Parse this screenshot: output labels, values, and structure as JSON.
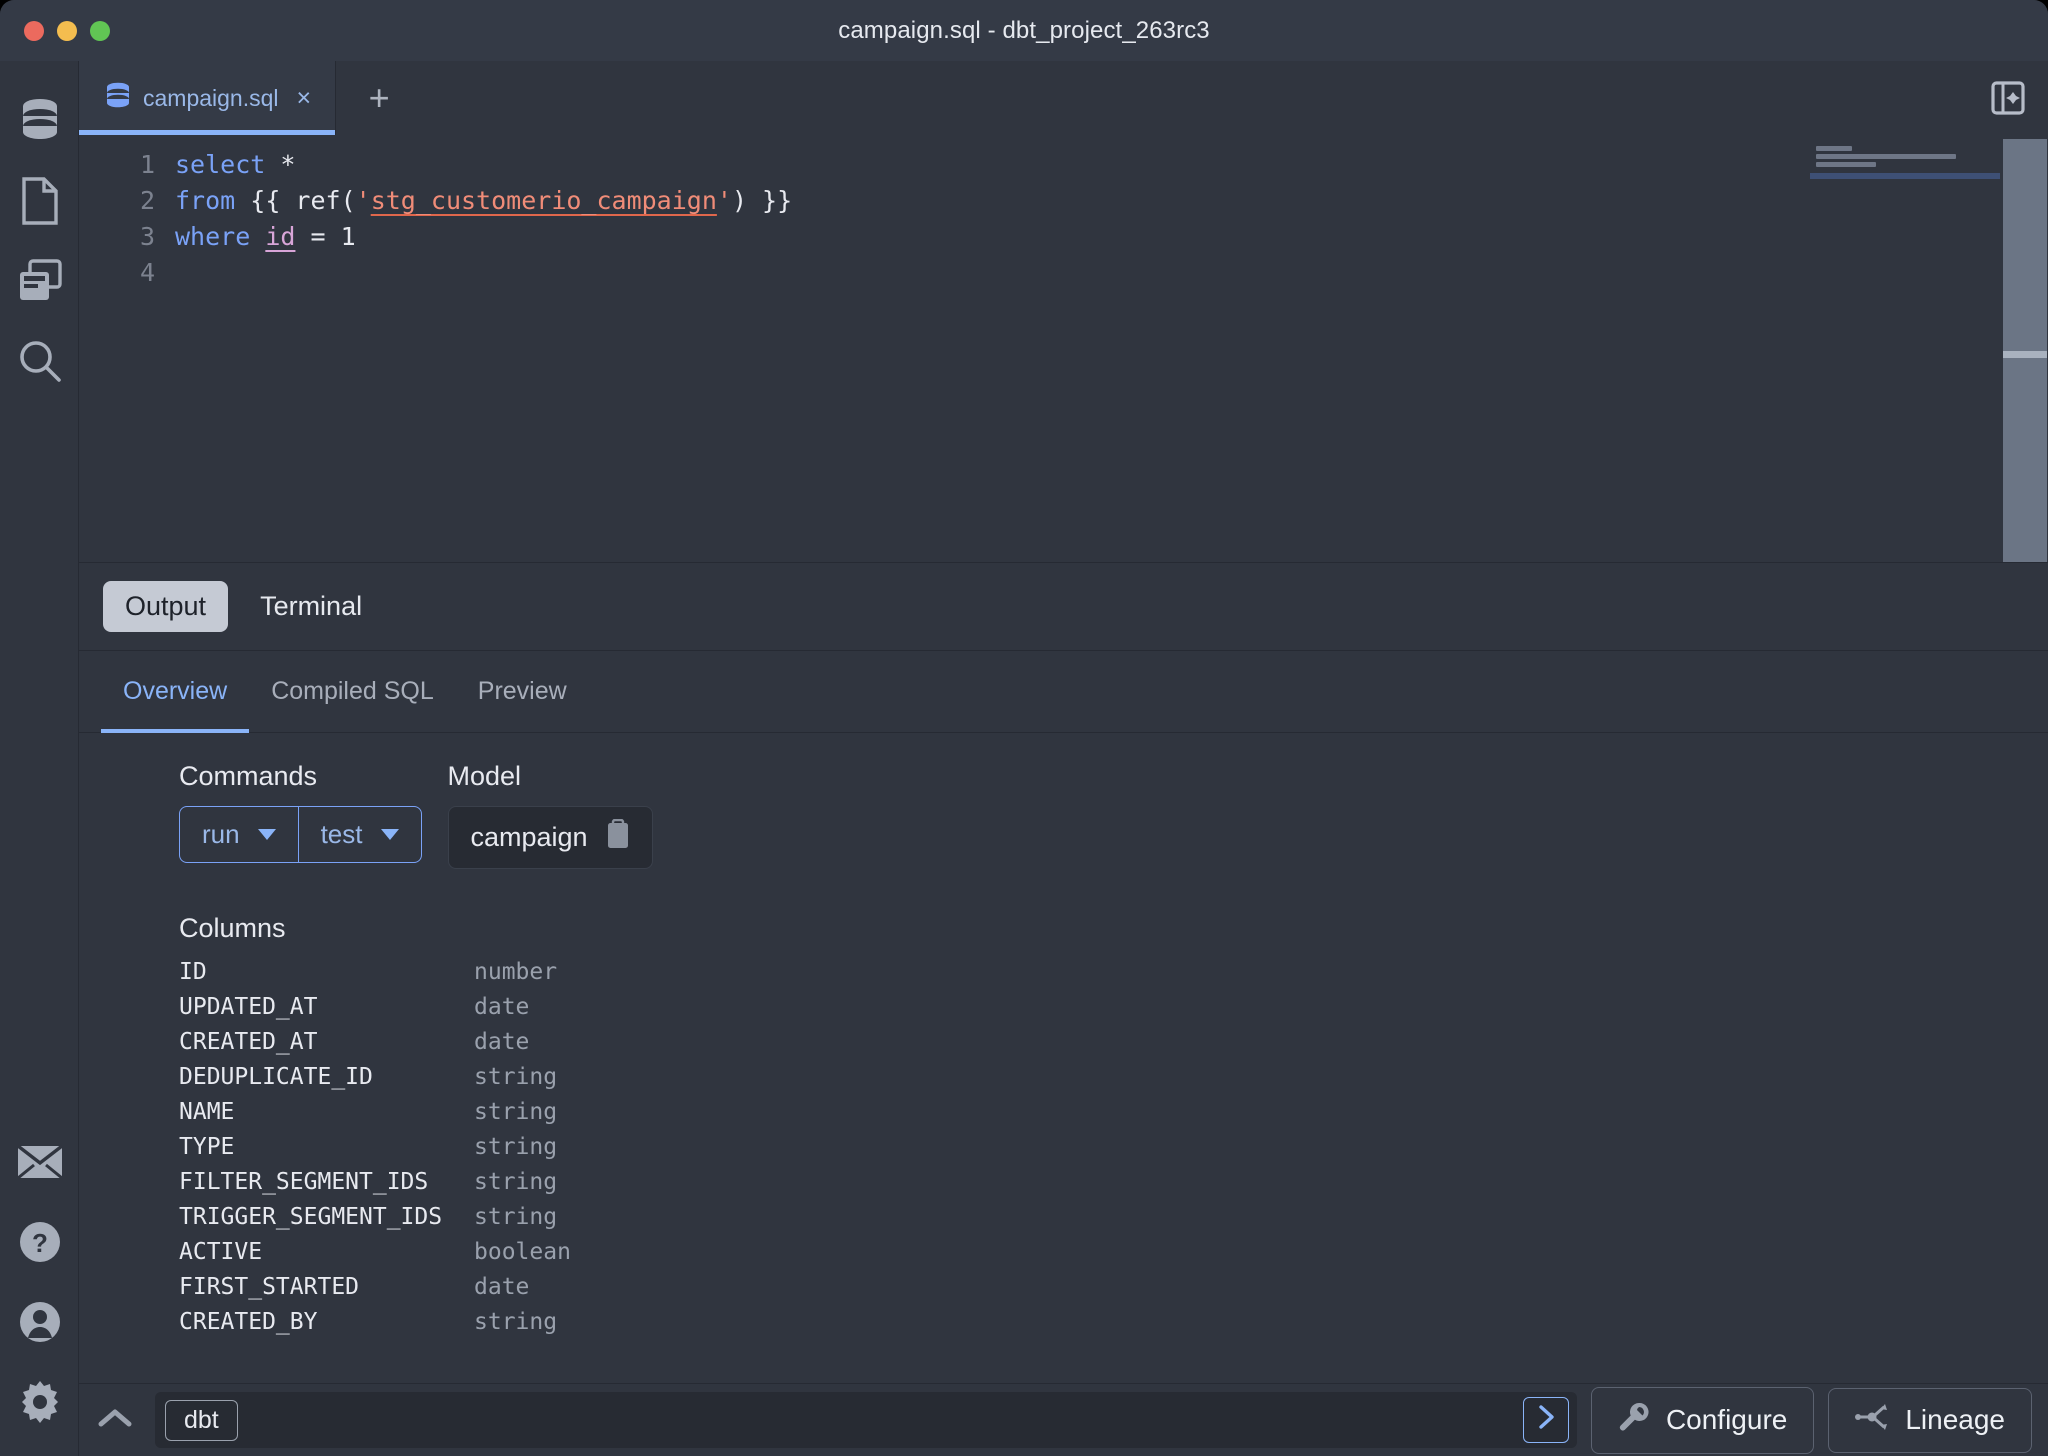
{
  "window": {
    "title": "campaign.sql - dbt_project_263rc3",
    "traffic_lights": [
      "close-red",
      "minimize-yellow",
      "maximize-green"
    ]
  },
  "rail": {
    "top_items": [
      {
        "name": "database-icon",
        "label": "Database"
      },
      {
        "name": "file-icon",
        "label": "File"
      },
      {
        "name": "copy-panels-icon",
        "label": "Panels"
      },
      {
        "name": "search-icon",
        "label": "Search"
      }
    ],
    "bottom_items": [
      {
        "name": "mail-icon",
        "label": "Mail"
      },
      {
        "name": "help-icon",
        "label": "Help"
      },
      {
        "name": "account-icon",
        "label": "Account"
      },
      {
        "name": "settings-gear-icon",
        "label": "Settings"
      }
    ]
  },
  "tabs": {
    "items": [
      {
        "label": "campaign.sql",
        "close": "×",
        "active": true
      }
    ],
    "new_tab_label": "+",
    "panel_toggle_name": "split-panel-add-icon"
  },
  "editor": {
    "lines": [
      {
        "num": "1",
        "segments": [
          {
            "text": "select",
            "cls": "kw"
          },
          {
            "text": " *",
            "cls": "plain"
          }
        ]
      },
      {
        "num": "2",
        "segments": [
          {
            "text": "from",
            "cls": "kw"
          },
          {
            "text": " {{ ref(",
            "cls": "jinja"
          },
          {
            "text": "'",
            "cls": "str"
          },
          {
            "text": "stg_customerio_campaign",
            "cls": "ref"
          },
          {
            "text": "'",
            "cls": "str"
          },
          {
            "text": ") }}",
            "cls": "jinja"
          }
        ]
      },
      {
        "num": "3",
        "segments": [
          {
            "text": "where",
            "cls": "kw"
          },
          {
            "text": " ",
            "cls": "plain"
          },
          {
            "text": "id",
            "cls": "ident"
          },
          {
            "text": " = ",
            "cls": "plain"
          },
          {
            "text": "1",
            "cls": "num"
          }
        ]
      },
      {
        "num": "4",
        "segments": []
      }
    ],
    "plain_text": "select *\nfrom {{ ref('stg_customerio_campaign') }}\nwhere id = 1\n"
  },
  "output": {
    "pane_tabs": [
      {
        "label": "Output",
        "selected": true
      },
      {
        "label": "Terminal",
        "selected": false
      }
    ],
    "sub_tabs": [
      {
        "label": "Overview",
        "selected": true
      },
      {
        "label": "Compiled SQL",
        "selected": false
      },
      {
        "label": "Preview",
        "selected": false
      }
    ],
    "commands": {
      "label": "Commands",
      "buttons": [
        {
          "label": "run",
          "caret": true
        },
        {
          "label": "test",
          "caret": true
        }
      ]
    },
    "model": {
      "label": "Model",
      "value": "campaign",
      "copy_icon": "clipboard-icon"
    },
    "columns": {
      "label": "Columns",
      "rows": [
        {
          "name": "ID",
          "type": "number"
        },
        {
          "name": "UPDATED_AT",
          "type": "date"
        },
        {
          "name": "CREATED_AT",
          "type": "date"
        },
        {
          "name": "DEDUPLICATE_ID",
          "type": "string"
        },
        {
          "name": "NAME",
          "type": "string"
        },
        {
          "name": "TYPE",
          "type": "string"
        },
        {
          "name": "FILTER_SEGMENT_IDS",
          "type": "string"
        },
        {
          "name": "TRIGGER_SEGMENT_IDS",
          "type": "string"
        },
        {
          "name": "ACTIVE",
          "type": "boolean"
        },
        {
          "name": "FIRST_STARTED",
          "type": "date"
        },
        {
          "name": "CREATED_BY",
          "type": "string"
        }
      ]
    }
  },
  "statusbar": {
    "collapse_icon": "chevron-up-icon",
    "command_chip": "dbt",
    "run_icon": "chevron-right-icon",
    "configure": {
      "label": "Configure",
      "icon": "wrench-icon"
    },
    "lineage": {
      "label": "Lineage",
      "icon": "lineage-icon"
    }
  },
  "colors": {
    "window_bg": "#30353f",
    "titlebar_bg": "#343a46",
    "accent_blue": "#8ab4f8",
    "keyword_blue": "#7aa2f7",
    "string_orange": "#f08c78",
    "identifier_pink": "#d8a5d8",
    "muted_text": "#9aa1ad"
  }
}
